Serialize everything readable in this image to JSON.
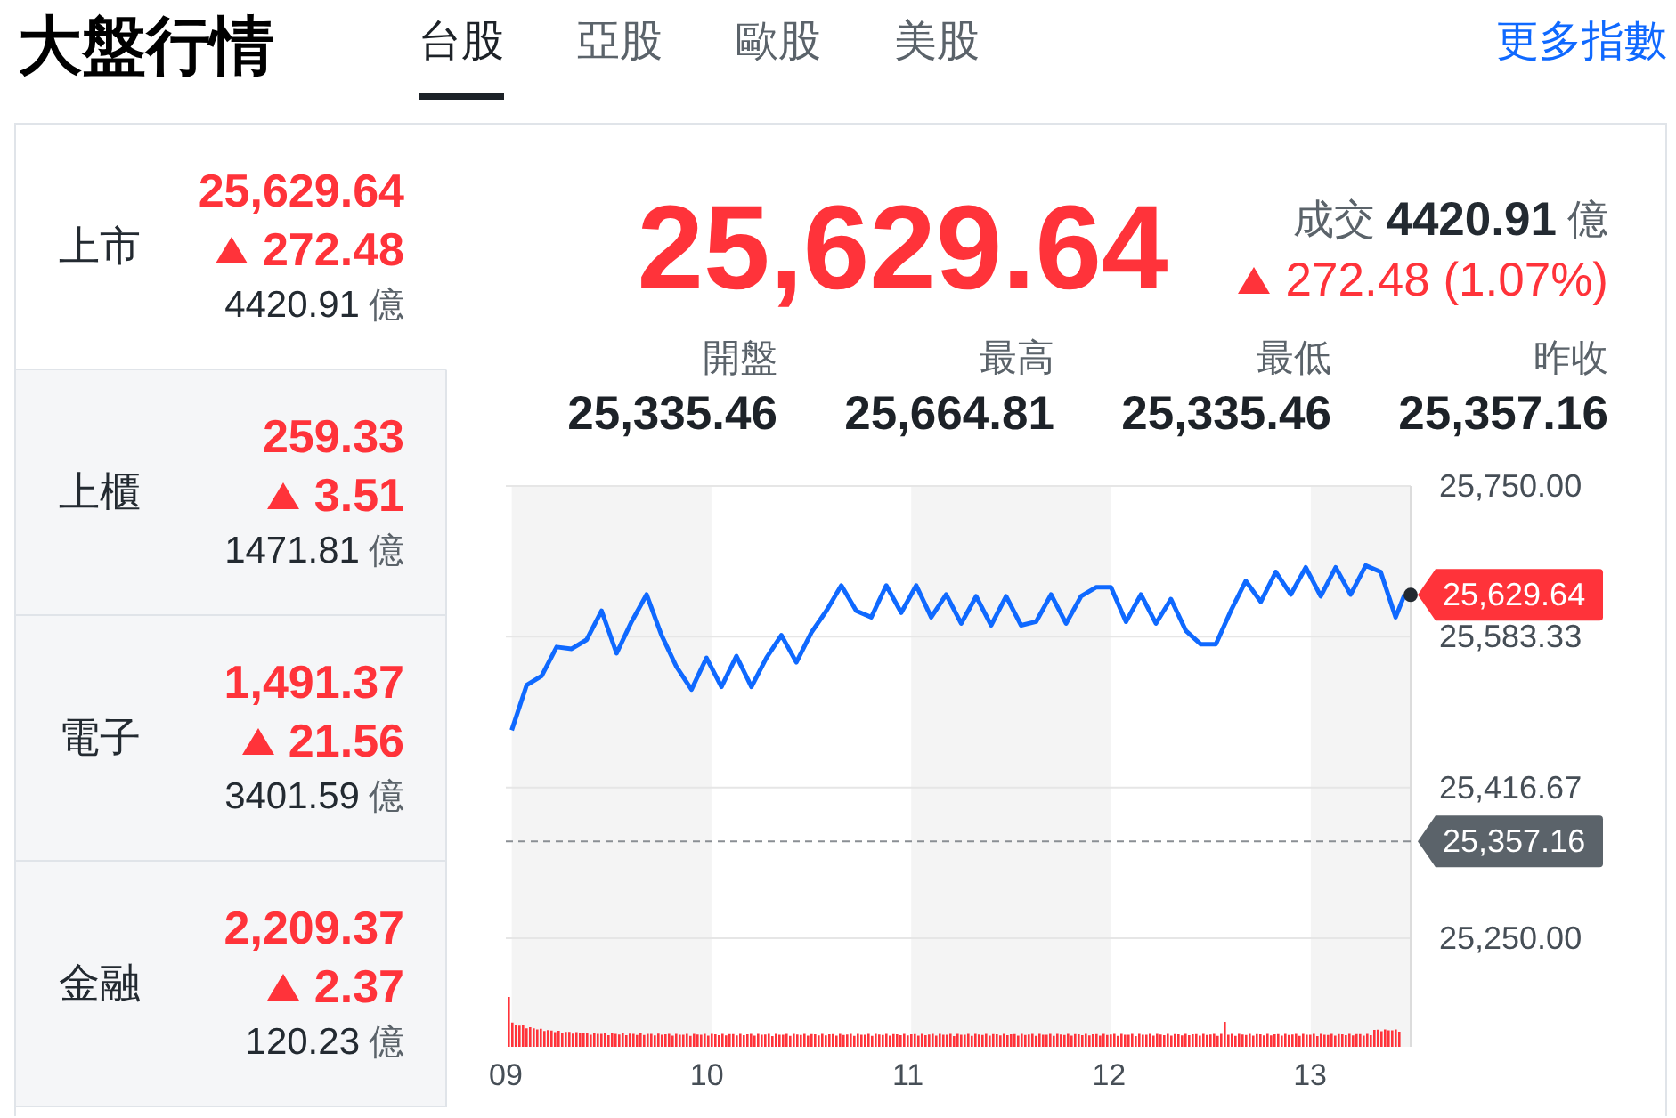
{
  "header": {
    "title": "大盤行情",
    "tabs": [
      {
        "label": "台股",
        "selected": true
      },
      {
        "label": "亞股",
        "selected": false
      },
      {
        "label": "歐股",
        "selected": false
      },
      {
        "label": "美股",
        "selected": false
      }
    ],
    "more_link": "更多指數"
  },
  "sidebar": {
    "items": [
      {
        "label": "上市",
        "selected": true,
        "price": "25,629.64",
        "up": true,
        "change": "272.48",
        "turnover": "4420.91",
        "unit": "億"
      },
      {
        "label": "上櫃",
        "selected": false,
        "price": "259.33",
        "up": true,
        "change": "3.51",
        "turnover": "1471.81",
        "unit": "億"
      },
      {
        "label": "電子",
        "selected": false,
        "price": "1,491.37",
        "up": true,
        "change": "21.56",
        "turnover": "3401.59",
        "unit": "億"
      },
      {
        "label": "金融",
        "selected": false,
        "price": "2,209.37",
        "up": true,
        "change": "2.37",
        "turnover": "120.23",
        "unit": "億"
      }
    ]
  },
  "summary": {
    "price": "25,629.64",
    "up": true,
    "turnover_label": "成交",
    "turnover": "4420.91",
    "unit": "億",
    "change": "272.48 (1.07%)"
  },
  "stats": [
    {
      "label": "開盤",
      "value": "25,335.46"
    },
    {
      "label": "最高",
      "value": "25,664.81"
    },
    {
      "label": "最低",
      "value": "25,335.46"
    },
    {
      "label": "昨收",
      "value": "25,357.16"
    }
  ],
  "chart": {
    "chart_data": {
      "type": "line",
      "x": [
        9.0,
        9.075,
        9.15,
        9.225,
        9.3,
        9.375,
        9.45,
        9.525,
        9.6,
        9.675,
        9.75,
        9.825,
        9.9,
        9.975,
        10.05,
        10.125,
        10.2,
        10.275,
        10.35,
        10.425,
        10.5,
        10.575,
        10.65,
        10.725,
        10.8,
        10.875,
        10.95,
        11.025,
        11.1,
        11.175,
        11.25,
        11.325,
        11.4,
        11.475,
        11.55,
        11.625,
        11.7,
        11.775,
        11.85,
        11.925,
        12.0,
        12.075,
        12.15,
        12.225,
        12.3,
        12.375,
        12.45,
        12.525,
        12.6,
        12.675,
        12.75,
        12.825,
        12.9,
        12.975,
        13.05,
        13.125,
        13.2,
        13.275,
        13.35,
        13.425,
        13.47
      ],
      "series": [
        {
          "color": "#0f69ff",
          "values": [
            25480,
            25530,
            25540,
            25572,
            25570,
            25580,
            25612,
            25565,
            25600,
            25630,
            25585,
            25550,
            25525,
            25560,
            25528,
            25562,
            25528,
            25560,
            25585,
            25555,
            25588,
            25612,
            25640,
            25612,
            25605,
            25640,
            25610,
            25640,
            25605,
            25630,
            25598,
            25628,
            25596,
            25628,
            25596,
            25600,
            25630,
            25598,
            25628,
            25638,
            25638,
            25600,
            25630,
            25598,
            25625,
            25590,
            25575,
            25575,
            25612,
            25645,
            25622,
            25655,
            25630,
            25660,
            25628,
            25660,
            25630,
            25662,
            25655,
            25605,
            25630
          ]
        }
      ],
      "xlim": [
        9,
        13.5
      ],
      "ylim": [
        25130,
        25750
      ],
      "grid": true,
      "xticks": [
        {
          "value": 9,
          "label": "09"
        },
        {
          "value": 10,
          "label": "10"
        },
        {
          "value": 11,
          "label": "11"
        },
        {
          "value": 12,
          "label": "12"
        },
        {
          "value": 13,
          "label": "13"
        }
      ],
      "yticks": [
        {
          "value": 25250,
          "label": "25,250.00"
        },
        {
          "value": 25416.67,
          "label": "25,416.67"
        },
        {
          "value": 25583.33,
          "label": "25,583.33"
        },
        {
          "value": 25750,
          "label": "25,750.00"
        }
      ],
      "bands": [
        {
          "axis": "x",
          "from": 9,
          "to": 10
        },
        {
          "axis": "x",
          "from": 11,
          "to": 12
        },
        {
          "axis": "x",
          "from": 13,
          "to": 13.5
        }
      ],
      "annotations": [
        {
          "text": "25,629.64",
          "x": 13.5,
          "y": 25629.64
        }
      ],
      "ref_lines": [
        {
          "axis": "y",
          "value": 25357.16,
          "label": "25,357.16"
        }
      ]
    }
  }
}
